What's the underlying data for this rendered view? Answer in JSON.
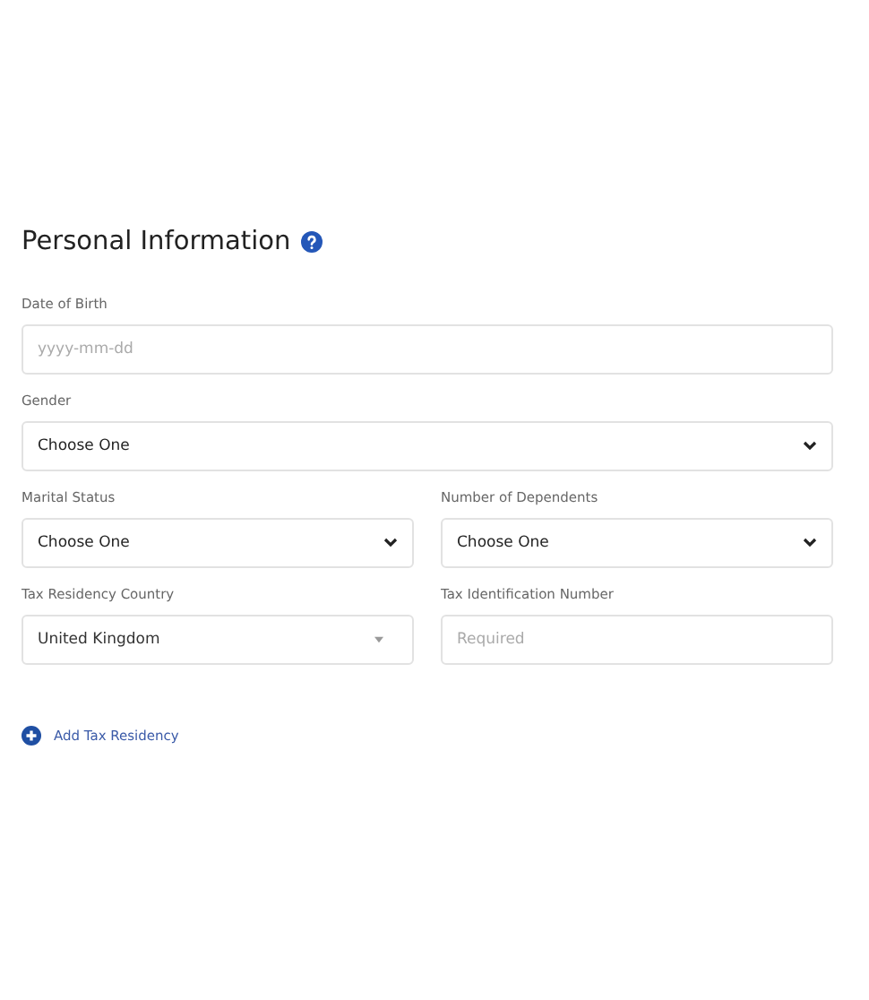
{
  "section": {
    "title": "Personal Information"
  },
  "rows": [
    [
      {
        "label": "Date of Birth",
        "kind": "text",
        "placeholder": "yyyy-mm-dd"
      }
    ],
    [
      {
        "label": "Gender",
        "kind": "select",
        "value": "Choose One"
      }
    ],
    [
      {
        "label": "Marital Status",
        "kind": "select",
        "value": "Choose One"
      },
      {
        "label": "Number of Dependents",
        "kind": "select",
        "value": "Choose One"
      }
    ],
    [
      {
        "label": "Tax Residency Country",
        "kind": "combo",
        "value": "United Kingdom"
      },
      {
        "label": "Tax Identification Number",
        "kind": "text",
        "placeholder": "Required"
      }
    ]
  ],
  "add_link": {
    "label": "Add Tax Residency"
  }
}
